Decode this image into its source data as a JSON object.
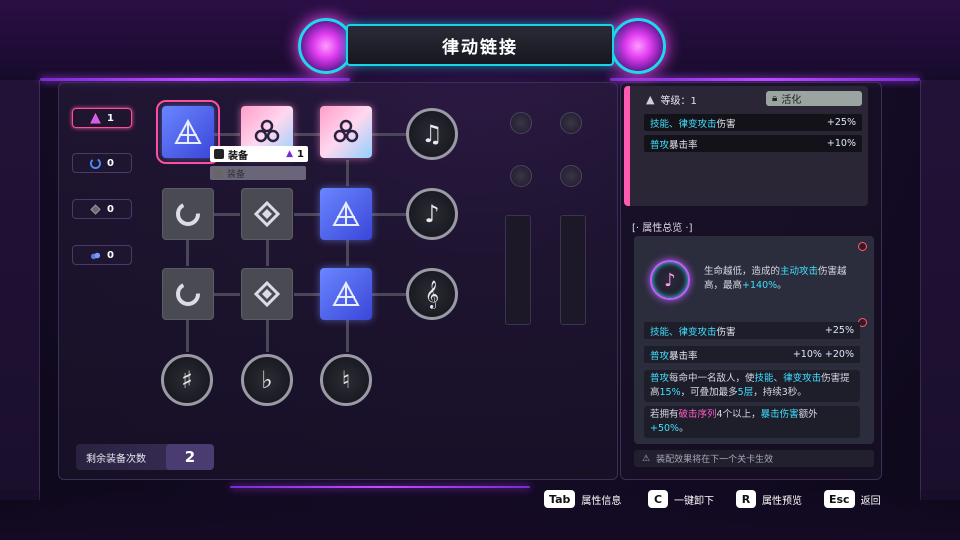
{
  "header": {
    "title": "律动链接"
  },
  "counters": [
    {
      "icon": "triangle-gem-icon",
      "value": "1",
      "active": true
    },
    {
      "icon": "swirl-icon",
      "value": "0",
      "active": false
    },
    {
      "icon": "diamond-icon",
      "value": "0",
      "active": false
    },
    {
      "icon": "cloud-icon",
      "value": "0",
      "active": false
    }
  ],
  "grid": {
    "rows": [
      [
        "blue-cross",
        "pink-hex",
        "pink-hex",
        "eighth-note"
      ],
      [
        "grey-swirl",
        "grey-diamond",
        "blue-cross",
        "single-note"
      ],
      [
        "grey-swirl",
        "grey-diamond",
        "blue-cross",
        "treble-clef"
      ],
      [
        "sharp",
        "flat",
        "natural"
      ]
    ],
    "note_glyphs": {
      "eighth-note": "♫",
      "single-note": "♪",
      "treble-clef": "𝄞",
      "sharp": "♯",
      "flat": "♭",
      "natural": "♮"
    }
  },
  "equip_popup": {
    "label": "装备",
    "count": "1",
    "sub_label": "装备"
  },
  "remaining": {
    "label": "剩余装备次数",
    "value": "2"
  },
  "level_card": {
    "level_label": "等级：1",
    "activate_label": "活化",
    "stats": [
      {
        "name_cyan": "技能、律变攻击",
        "name_rest": "伤害",
        "value": "+25%"
      },
      {
        "name_cyan": "普攻",
        "name_rest": "暴击率",
        "value": "+10%"
      }
    ]
  },
  "overview": {
    "title": "[· 属性总览 ·]",
    "desc_a": "生命越低，造成的",
    "desc_b": "主动攻击",
    "desc_c": "伤害越高，最高",
    "desc_d": "+140%",
    "desc_e": "。",
    "stats": [
      {
        "name_cyan": "技能、律变攻击",
        "name_rest": "伤害",
        "value": "+25%"
      },
      {
        "name_cyan": "普攻",
        "name_rest": "暴击率",
        "value": "+10% +20%"
      }
    ],
    "note1": {
      "a": "普攻",
      "b": "每命中一名敌人，使",
      "c": "技能",
      "d": "、",
      "e": "律变攻击",
      "f": "伤害提高",
      "g": "15%",
      "h": "，可叠加最多",
      "i": "5层",
      "j": "，持续3秒。"
    },
    "note2": {
      "a": "若拥有",
      "b": "破击序列",
      "c": "4个以上，",
      "d": "暴击伤害",
      "e": "额外",
      "f": "+50%",
      "g": "。"
    },
    "footer": "装配效果将在下一个关卡生效"
  },
  "keys": [
    {
      "key": "Tab",
      "label": "属性信息"
    },
    {
      "key": "C",
      "label": "一键卸下"
    },
    {
      "key": "R",
      "label": "属性预览"
    },
    {
      "key": "Esc",
      "label": "返回"
    }
  ],
  "colors": {
    "accent_cyan": "#3fe0ff",
    "accent_magenta": "#ff5cc8",
    "tile_blue": "#5a6cf0",
    "frame_purple": "#2a0f45"
  }
}
